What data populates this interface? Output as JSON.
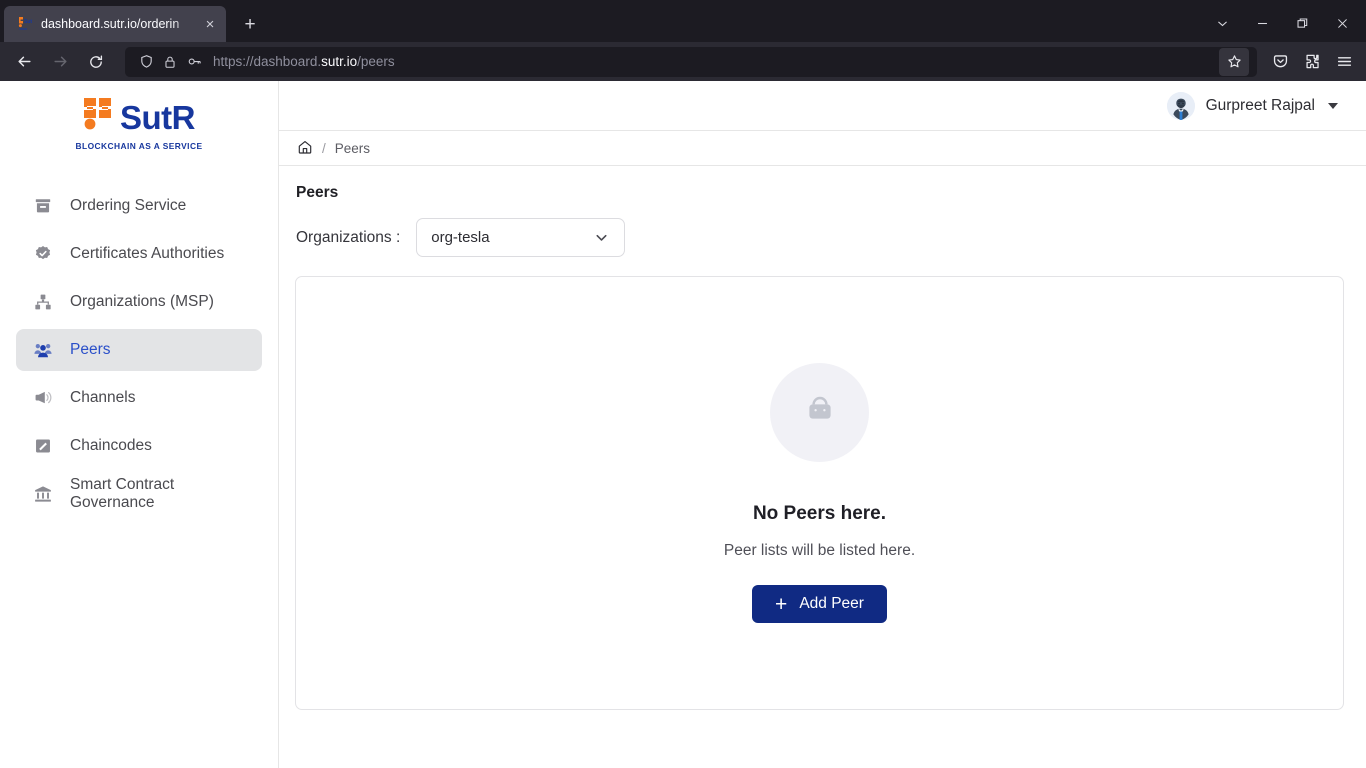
{
  "browser": {
    "tab": {
      "title": "dashboard.sutr.io/orderin",
      "favicon_name": "sutr-favicon",
      "close_label": "×"
    },
    "newtab_label": "+",
    "window_controls": {
      "tablist": "tab-list-chevron",
      "minimize": "minimize",
      "maximize": "maximize",
      "close": "close"
    },
    "toolbar": {
      "back": "back-arrow",
      "forward": "forward-arrow",
      "reload": "reload",
      "shield_icon": "shield-icon",
      "lock_icon": "lock-icon",
      "key_icon": "key-icon",
      "url_prefix": "https://dashboard.",
      "url_host_highlight": "sutr.io",
      "url_path": "/peers",
      "bookmark": "star-icon",
      "pocket": "pocket-icon",
      "extensions": "extensions-icon",
      "appmenu": "hamburger-icon"
    }
  },
  "sidebar": {
    "logo": {
      "text": "SutR",
      "tagline": "BLOCKCHAIN AS A SERVICE",
      "mark_color": "#f47b20",
      "text_color": "#17379e"
    },
    "items": [
      {
        "label": "Ordering Service",
        "icon": "archive-icon",
        "active": false
      },
      {
        "label": "Certificates Authorities",
        "icon": "verified-badge-icon",
        "active": false
      },
      {
        "label": "Organizations (MSP)",
        "icon": "sitemap-icon",
        "active": false
      },
      {
        "label": "Peers",
        "icon": "people-icon",
        "active": true
      },
      {
        "label": "Channels",
        "icon": "megaphone-icon",
        "active": false
      },
      {
        "label": "Chaincodes",
        "icon": "tag-icon",
        "active": false
      },
      {
        "label": "Smart Contract Governance",
        "icon": "bank-icon",
        "active": false
      }
    ]
  },
  "topbar": {
    "user_name": "Gurpreet Rajpal",
    "avatar_name": "user-avatar",
    "caret_icon": "chevron-down-icon"
  },
  "breadcrumb": {
    "home_icon": "home-icon",
    "separator": "/",
    "current": "Peers"
  },
  "main": {
    "page_title": "Peers",
    "filter_label": "Organizations :",
    "organization_selected": "org-tesla",
    "organization_options": [
      "org-tesla"
    ],
    "empty_state": {
      "icon": "shopping-bag-icon",
      "title": "No Peers here.",
      "subtitle": "Peer lists will be listed here.",
      "button_label": "Add Peer",
      "button_plus": "+",
      "button_color": "#102a83"
    }
  }
}
